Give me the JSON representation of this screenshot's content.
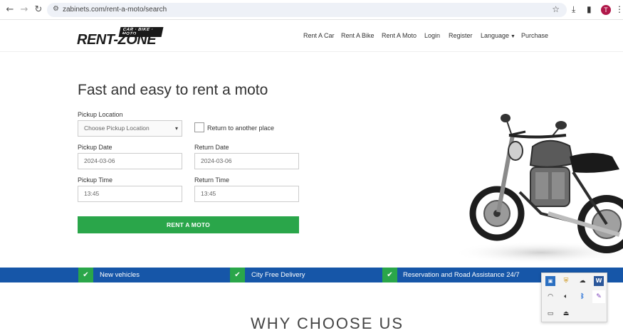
{
  "browser": {
    "url": "zabinets.com/rent-a-moto/search",
    "profile_initial": "T",
    "icons": [
      "back-arrow-icon",
      "forward-arrow-icon",
      "reload-icon",
      "site-settings-icon",
      "bookmark-star-icon",
      "download-icon",
      "side-panel-icon",
      "more-menu-icon"
    ]
  },
  "header": {
    "logo_text": "RENT-ZONE",
    "logo_strap": "CAR · BIKE · MOTO",
    "menu": [
      "Rent A Car",
      "Rent A Bike",
      "Rent A Moto",
      "Login",
      "Register",
      "Language",
      "Purchase"
    ]
  },
  "form": {
    "title": "Fast and easy to rent a moto",
    "pickup_location_label": "Pickup Location",
    "pickup_location_value": "Choose Pickup Location",
    "return_another_label": "Return to another place",
    "pickup_date_label": "Pickup Date",
    "pickup_date_value": "2024-03-06",
    "return_date_label": "Return Date",
    "return_date_value": "2024-03-06",
    "pickup_time_label": "Pickup Time",
    "pickup_time_value": "13:45",
    "return_time_label": "Return Time",
    "return_time_value": "13:45",
    "submit_label": "RENT A MOTO"
  },
  "features": [
    "New vehicles",
    "City Free Delivery",
    "Reservation and Road Assistance 24/7"
  ],
  "section_heading": "WHY CHOOSE US",
  "colors": {
    "brand_blue": "#1656a8",
    "accent_green": "#2aa64a"
  },
  "tray": {
    "icons": [
      "app-icon",
      "shield-icon",
      "cloud-off-icon",
      "word-icon",
      "wifi-icon",
      "volume-icon",
      "bluetooth-icon",
      "pen-icon",
      "battery-icon",
      "usb-icon"
    ],
    "word_letter": "W"
  }
}
